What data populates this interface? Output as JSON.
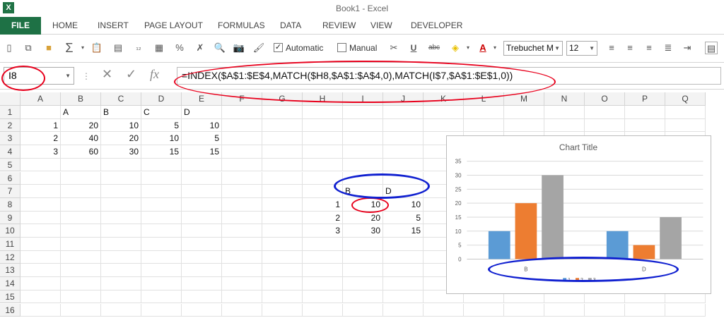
{
  "window": {
    "title": "Book1 - Excel",
    "logo": "X"
  },
  "ribbon": {
    "tabs": [
      "FILE",
      "HOME",
      "INSERT",
      "PAGE LAYOUT",
      "FORMULAS",
      "DATA",
      "REVIEW",
      "VIEW",
      "DEVELOPER"
    ]
  },
  "toolbar": {
    "automatic_label": "Automatic",
    "manual_label": "Manual",
    "font_name": "Trebuchet M",
    "font_size": "12",
    "icons": [
      "new-icon",
      "copy-icon",
      "open-icon",
      "autosum-icon",
      "paste-icon",
      "paste-values-icon",
      "number-format-icon",
      "format-painter-icon",
      "find-icon",
      "camera-icon",
      "brush-icon",
      "cut-icon",
      "underline-icon",
      "strikethrough-icon",
      "fill-color-icon",
      "font-color-icon",
      "align-left-icon",
      "align-center-icon",
      "align-right-icon",
      "justify-icon",
      "wrap-icon"
    ]
  },
  "formula_bar": {
    "name_box": "I8",
    "formula": "=INDEX($A$1:$E$4,MATCH($H8,$A$1:$A$4,0),MATCH(I$7,$A$1:$E$1,0))"
  },
  "columns": [
    "A",
    "B",
    "C",
    "D",
    "E",
    "F",
    "G",
    "H",
    "I",
    "J",
    "K",
    "L",
    "M",
    "N",
    "O",
    "P",
    "Q"
  ],
  "rows": [
    "1",
    "2",
    "3",
    "4",
    "5",
    "6",
    "7",
    "8",
    "9",
    "10",
    "11",
    "12",
    "13",
    "14",
    "15",
    "16"
  ],
  "cells": {
    "B1": "A",
    "C1": "B",
    "D1": "C",
    "E1": "D",
    "A2": "1",
    "B2": "20",
    "C2": "10",
    "D2": "5",
    "E2": "10",
    "A3": "2",
    "B3": "40",
    "C3": "20",
    "D3": "10",
    "E3": "5",
    "A4": "3",
    "B4": "60",
    "C4": "30",
    "D4": "15",
    "E4": "15",
    "I7": "B",
    "J7": "D",
    "H8": "1",
    "I8": "10",
    "J8": "10",
    "H9": "2",
    "I9": "20",
    "J9": "5",
    "H10": "3",
    "I10": "30",
    "J10": "15"
  },
  "colors": {
    "excel_green": "#217346",
    "series1": "#5b9bd5",
    "series2": "#ed7d31",
    "series3": "#a5a5a5",
    "annotation_red": "#e8001c",
    "annotation_blue": "#1020d0"
  },
  "chart_data": {
    "type": "bar",
    "title": "Chart Title",
    "categories": [
      "B",
      "D"
    ],
    "series": [
      {
        "name": "1",
        "values": [
          10,
          10
        ]
      },
      {
        "name": "2",
        "values": [
          20,
          5
        ]
      },
      {
        "name": "3",
        "values": [
          30,
          15
        ]
      }
    ],
    "ylim": [
      0,
      35
    ],
    "yticks": [
      0,
      5,
      10,
      15,
      20,
      25,
      30,
      35
    ],
    "grid": true,
    "legend": "bottom"
  }
}
